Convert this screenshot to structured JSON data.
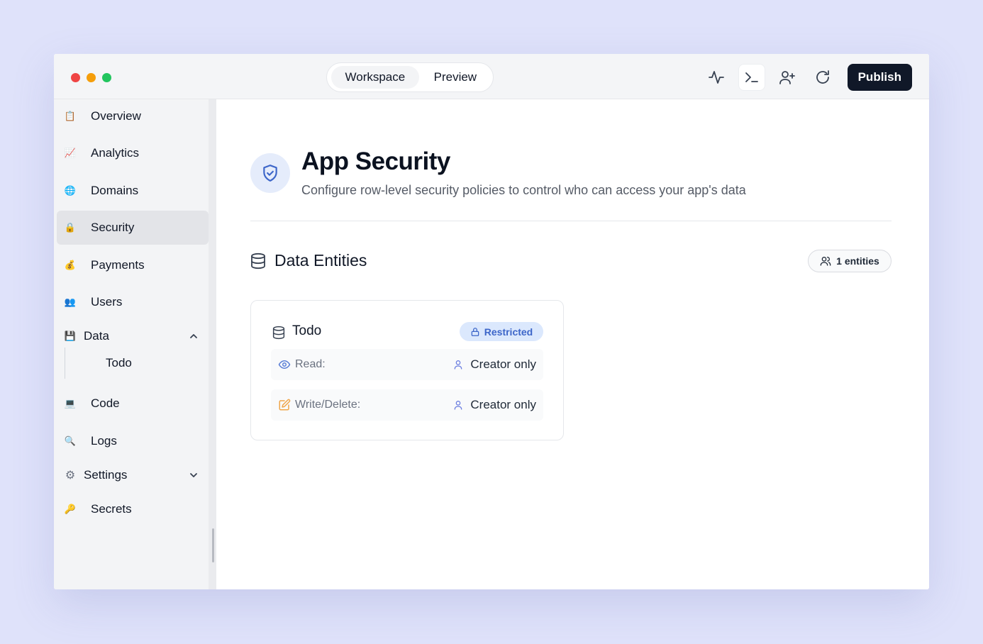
{
  "topbar": {
    "tabs": [
      {
        "label": "Workspace",
        "active": true
      },
      {
        "label": "Preview",
        "active": false
      }
    ],
    "icons": [
      "activity-icon",
      "terminal-icon",
      "add-user-icon",
      "refresh-icon"
    ],
    "publish_label": "Publish"
  },
  "sidebar": {
    "items": [
      {
        "label": "Overview",
        "icon": "📋"
      },
      {
        "label": "Analytics",
        "icon": "📈"
      },
      {
        "label": "Domains",
        "icon": "🌐"
      },
      {
        "label": "Security",
        "icon": "🔒",
        "active": true
      },
      {
        "label": "Payments",
        "icon": "💰"
      },
      {
        "label": "Users",
        "icon": "👥"
      },
      {
        "label": "Data",
        "icon": "💾",
        "expanded": true
      },
      {
        "label": "Code",
        "icon": "💻"
      },
      {
        "label": "Logs",
        "icon": "🔍"
      },
      {
        "label": "Settings",
        "icon": "⚙",
        "expanded": false
      },
      {
        "label": "Secrets",
        "icon": "🔑"
      }
    ],
    "data_children": [
      {
        "label": "Todo"
      }
    ]
  },
  "page": {
    "title": "App Security",
    "subtitle": "Configure row-level security policies to control who can access your app's data"
  },
  "entities": {
    "section_title": "Data Entities",
    "count_label": "1 entities",
    "cards": [
      {
        "name": "Todo",
        "badge": "Restricted",
        "permissions": [
          {
            "label": "Read:",
            "value": "Creator only"
          },
          {
            "label": "Write/Delete:",
            "value": "Creator only"
          }
        ]
      }
    ]
  },
  "colors": {
    "accent": "#3d66c9",
    "badge_bg": "#dbe8fd",
    "publish_bg": "#101828",
    "background": "#dfe2fa"
  }
}
